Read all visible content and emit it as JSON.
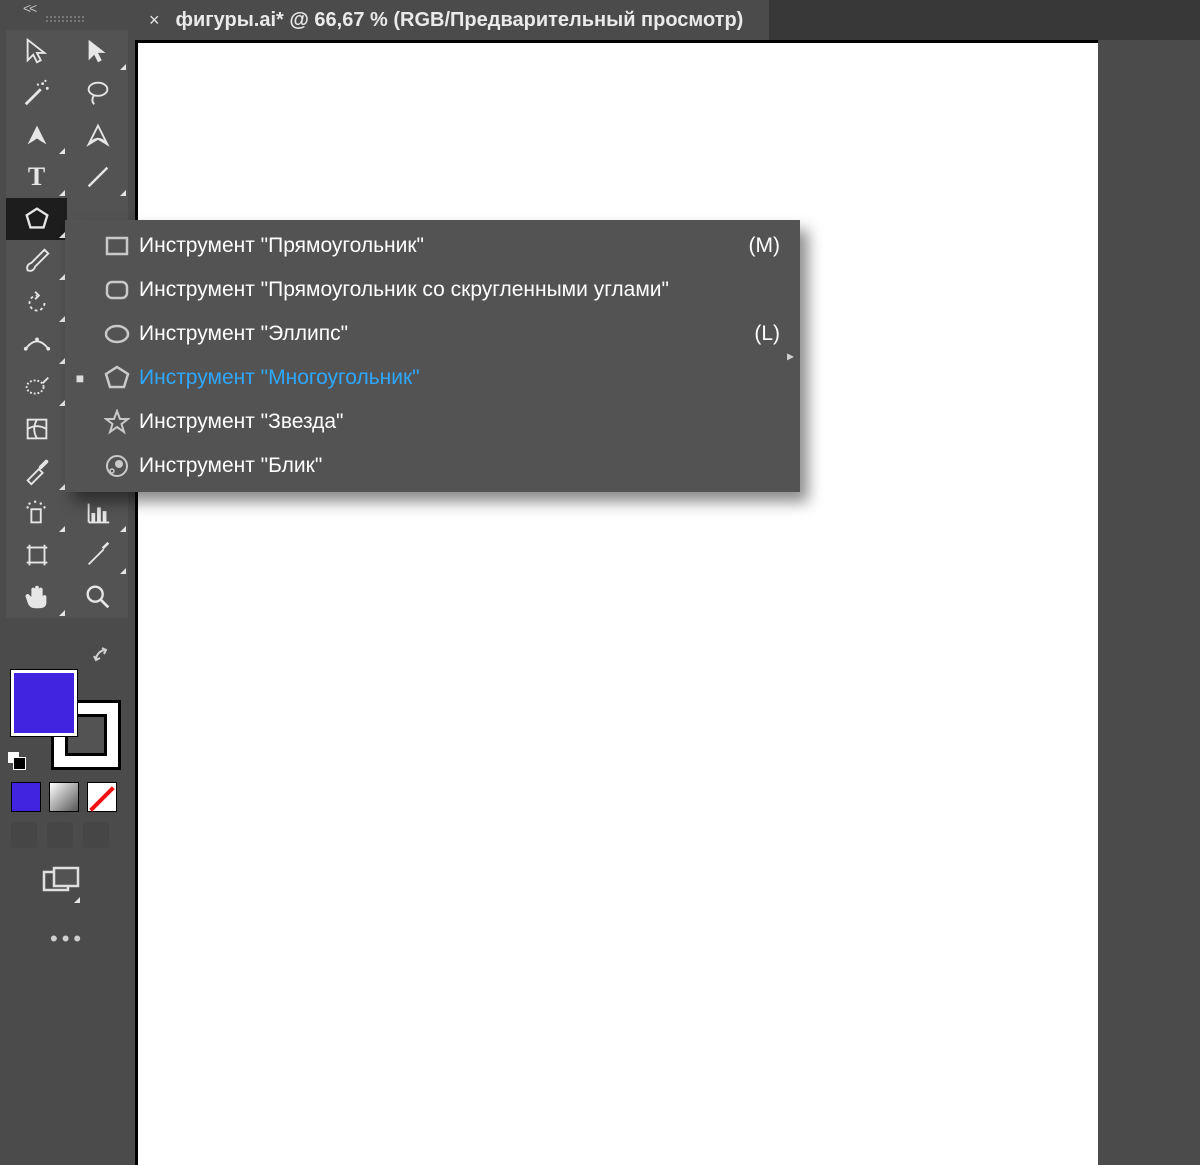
{
  "header": {
    "chevrons": "<<"
  },
  "tab": {
    "close": "×",
    "title": "фигуры.ai* @ 66,67 % (RGB/Предварительный просмотр)"
  },
  "colors": {
    "fill": "#4124e0",
    "stroke": "#000000",
    "panel": "#535353",
    "bg": "#4b4b4b"
  },
  "flyout": {
    "items": [
      {
        "icon": "rectangle",
        "label": "Инструмент \"Прямоугольник\"",
        "shortcut": "(M)",
        "active": false,
        "mark": ""
      },
      {
        "icon": "roundrect",
        "label": "Инструмент \"Прямоугольник со скругленными углами\"",
        "shortcut": "",
        "active": false,
        "mark": ""
      },
      {
        "icon": "ellipse",
        "label": "Инструмент \"Эллипс\"",
        "shortcut": "(L)",
        "active": false,
        "mark": ""
      },
      {
        "icon": "polygon",
        "label": "Инструмент \"Многоугольник\"",
        "shortcut": "",
        "active": true,
        "mark": "■"
      },
      {
        "icon": "star",
        "label": "Инструмент \"Звезда\"",
        "shortcut": "",
        "active": false,
        "mark": ""
      },
      {
        "icon": "flare",
        "label": "Инструмент \"Блик\"",
        "shortcut": "",
        "active": false,
        "mark": ""
      }
    ]
  },
  "more": "•••"
}
